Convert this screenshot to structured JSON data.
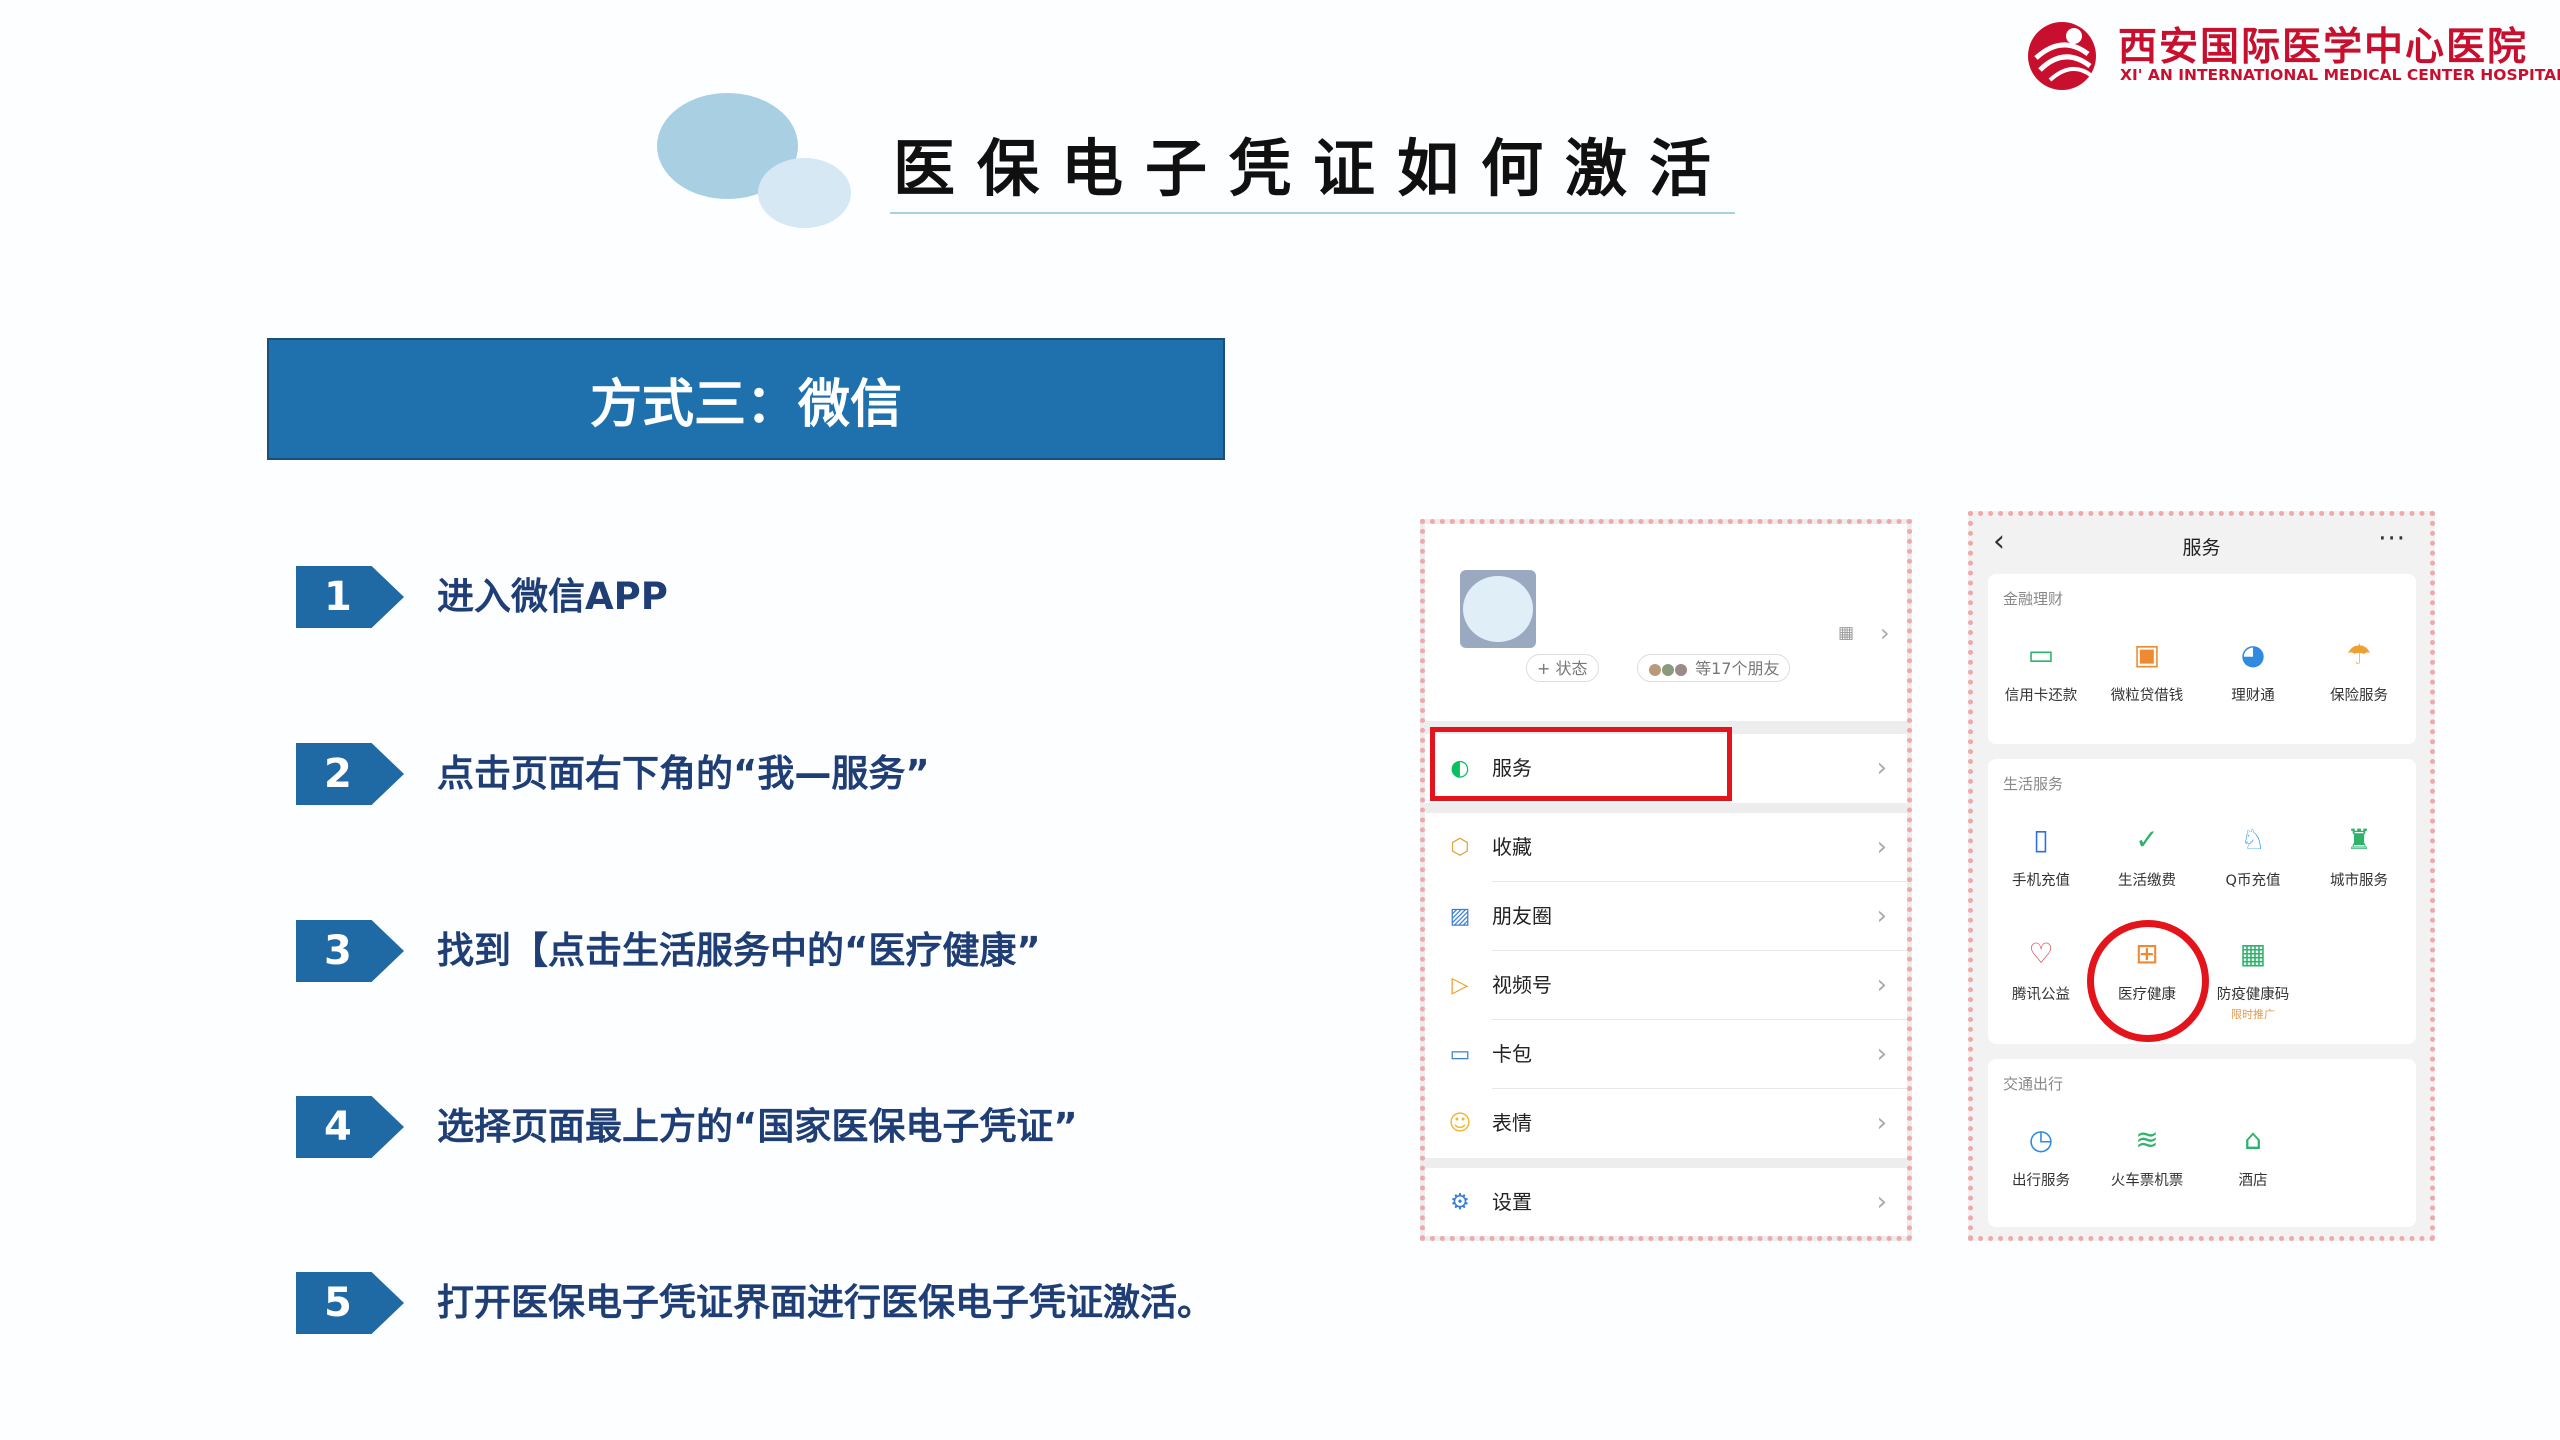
{
  "logo": {
    "name_cn": "西安国际医学中心医院",
    "name_en": "XI' AN INTERNATIONAL MEDICAL CENTER HOSPITAL"
  },
  "title": "医保电子凭证如何激活",
  "banner": "方式三：微信",
  "steps": [
    {
      "num": "1",
      "text": "进入微信APP"
    },
    {
      "num": "2",
      "text": "点击页面右下角的“我—服务”"
    },
    {
      "num": "3",
      "text": "找到【点击生活服务中的“医疗健康”"
    },
    {
      "num": "4",
      "text": "选择页面最上方的“国家医保电子凭证”"
    },
    {
      "num": "5",
      "text": "打开医保电子凭证界面进行医保电子凭证激活。"
    }
  ],
  "wechat_me": {
    "status_label": "+ 状态",
    "friends_label": "等17个朋友",
    "menu": [
      {
        "label": "服务",
        "icon": "service-icon"
      },
      {
        "label": "收藏",
        "icon": "favorites-cube-icon"
      },
      {
        "label": "朋友圈",
        "icon": "moments-image-icon"
      },
      {
        "label": "视频号",
        "icon": "channels-play-icon"
      },
      {
        "label": "卡包",
        "icon": "card-wallet-icon"
      },
      {
        "label": "表情",
        "icon": "sticker-smile-icon"
      },
      {
        "label": "设置",
        "icon": "settings-gear-icon"
      }
    ]
  },
  "wechat_services": {
    "title": "服务",
    "sections": [
      {
        "header": "金融理财",
        "items": [
          {
            "label": "信用卡还款",
            "icon": "credit-card-icon"
          },
          {
            "label": "微粒贷借钱",
            "icon": "loan-wallet-icon"
          },
          {
            "label": "理财通",
            "icon": "wealth-icon"
          },
          {
            "label": "保险服务",
            "icon": "insurance-umbrella-icon"
          }
        ]
      },
      {
        "header": "生活服务",
        "items": [
          {
            "label": "手机充值",
            "icon": "phone-topup-icon"
          },
          {
            "label": "生活缴费",
            "icon": "utility-bill-icon"
          },
          {
            "label": "Q币充值",
            "icon": "qq-coin-icon"
          },
          {
            "label": "城市服务",
            "icon": "city-service-icon"
          },
          {
            "label": "腾讯公益",
            "icon": "charity-heart-icon"
          },
          {
            "label": "医疗健康",
            "icon": "medical-health-icon"
          },
          {
            "label": "防疫健康码",
            "icon": "health-qr-code-icon",
            "sub": "限时推广"
          }
        ]
      },
      {
        "header": "交通出行",
        "items": [
          {
            "label": "出行服务",
            "icon": "travel-compass-icon"
          },
          {
            "label": "火车票机票",
            "icon": "train-plane-ticket-icon"
          },
          {
            "label": "酒店",
            "icon": "hotel-bed-icon"
          }
        ]
      }
    ]
  }
}
